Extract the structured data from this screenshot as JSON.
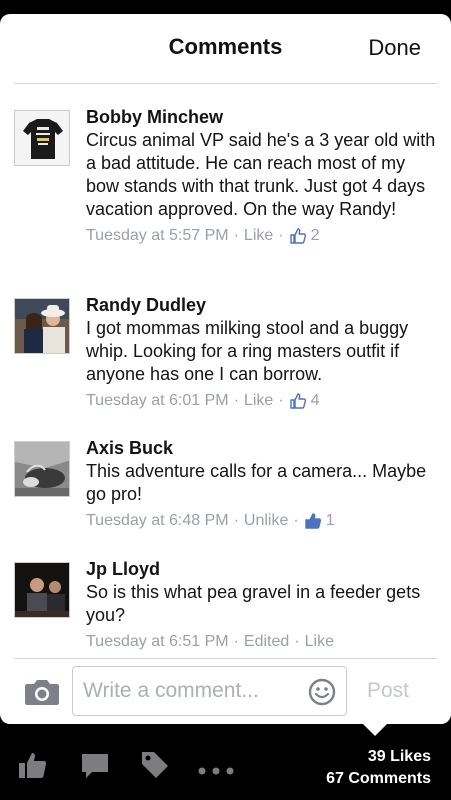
{
  "header": {
    "title": "Comments",
    "done_label": "Done"
  },
  "comments": [
    {
      "author": "Bobby Minchew",
      "text": "Circus animal VP said he's a 3 year old with a bad attitude.  He can reach most of my bow stands with that trunk.  Just got 4 days vacation approved.   On the way Randy!",
      "time": "Tuesday at 5:57 PM",
      "action": "Like",
      "like_count": "2"
    },
    {
      "author": "Randy Dudley",
      "text": "I got mommas milking stool and a buggy whip.  Looking for a ring masters outfit if anyone has one I can borrow.",
      "time": "Tuesday at 6:01 PM",
      "action": "Like",
      "like_count": "4"
    },
    {
      "author": "Axis Buck",
      "text": "This adventure calls for a camera... Maybe go pro!",
      "time": "Tuesday at 6:48 PM",
      "action": "Unlike",
      "like_count": "1"
    },
    {
      "author": "Jp Lloyd",
      "text": "So is this what pea gravel in a feeder gets you?",
      "time": "Tuesday at 6:51 PM",
      "edited_label": "Edited",
      "action": "Like"
    }
  ],
  "composer": {
    "placeholder": "Write a comment...",
    "post_label": "Post"
  },
  "footer": {
    "likes_label": "39 Likes",
    "comments_label": "67 Comments"
  },
  "colors": {
    "like_blue": "#4a72c4",
    "meta_gray": "#9aa0a8",
    "toolbar_icon": "#7d7d80"
  },
  "icons": [
    "thumbs-up-icon",
    "camera-icon",
    "smiley-icon",
    "like-icon",
    "comment-icon",
    "tag-icon",
    "more-icon"
  ]
}
